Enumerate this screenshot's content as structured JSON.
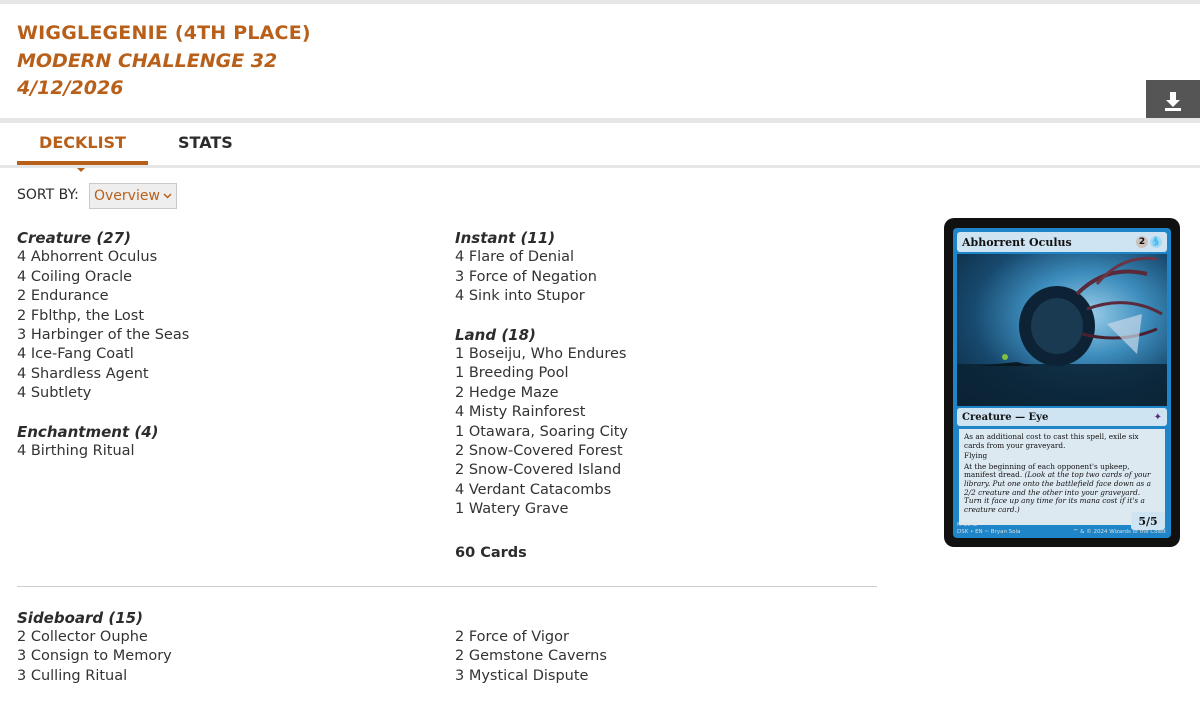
{
  "header": {
    "player": "WIGGLEGENIE (4TH PLACE)",
    "event": "MODERN CHALLENGE 32",
    "date": "4/12/2026"
  },
  "tabs": [
    {
      "label": "DECKLIST",
      "active": true
    },
    {
      "label": "STATS",
      "active": false
    }
  ],
  "sort": {
    "label": "SORT BY:",
    "selected": "Overview"
  },
  "decklist": {
    "creature": {
      "heading": "Creature (27)",
      "cards": [
        "4 Abhorrent Oculus",
        "4 Coiling Oracle",
        "2 Endurance",
        "2 Fblthp, the Lost",
        "3 Harbinger of the Seas",
        "4 Ice-Fang Coatl",
        "4 Shardless Agent",
        "4 Subtlety"
      ]
    },
    "enchantment": {
      "heading": "Enchantment (4)",
      "cards": [
        "4 Birthing Ritual"
      ]
    },
    "instant": {
      "heading": "Instant (11)",
      "cards": [
        "4 Flare of Denial",
        "3 Force of Negation",
        "4 Sink into Stupor"
      ]
    },
    "land": {
      "heading": "Land (18)",
      "cards": [
        "1 Boseiju, Who Endures",
        "1 Breeding Pool",
        "2 Hedge Maze",
        "4 Misty Rainforest",
        "1 Otawara, Soaring City",
        "2 Snow-Covered Forest",
        "2 Snow-Covered Island",
        "4 Verdant Catacombs",
        "1 Watery Grave"
      ]
    },
    "total": "60 Cards",
    "sideboard": {
      "heading": "Sideboard (15)",
      "left": [
        "2 Collector Ouphe",
        "3 Consign to Memory",
        "3 Culling Ritual"
      ],
      "right": [
        "2 Force of Vigor",
        "2 Gemstone Caverns",
        "3 Mystical Dispute"
      ]
    }
  },
  "card_preview": {
    "name": "Abhorrent Oculus",
    "mana_generic": "2",
    "type_line": "Creature — Eye",
    "rules_text": "As an additional cost to cast this spell, exile six cards from your graveyard.",
    "keyword": "Flying",
    "ability_text": "At the beginning of each opponent's upkeep, manifest dread.",
    "reminder_text": "(Look at the top two cards of your library. Put one onto the battlefield face down as a 2/2 creature and the other into your graveyard. Turn it face up any time for its mana cost if it's a creature card.)",
    "power_toughness": "5/5",
    "collector_number": "M 0042",
    "set_line": "DSK • EN",
    "artist": "Bryan Sola",
    "copyright": "™ & © 2024 Wizards of the Coast"
  },
  "colors": {
    "accent": "#b8601a",
    "download_bg": "#555555"
  }
}
